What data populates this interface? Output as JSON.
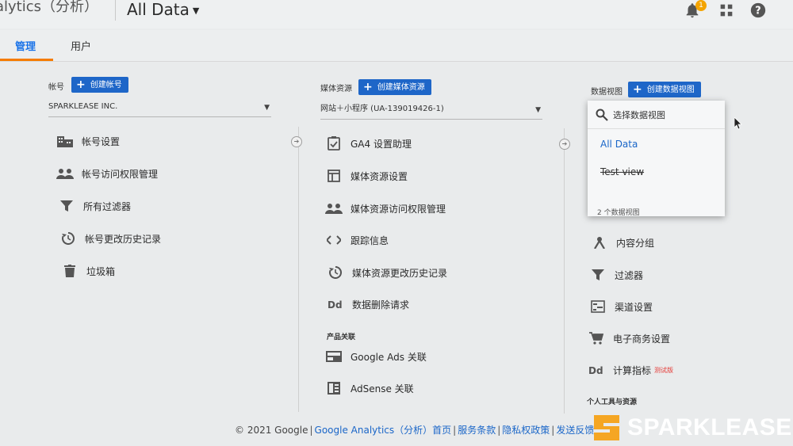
{
  "header": {
    "app_title": "alytics（分析）",
    "data_view": "All Data",
    "notification_count": "1"
  },
  "tabs": [
    {
      "label": "管理"
    },
    {
      "label": "用户"
    }
  ],
  "account_column": {
    "label": "帐号",
    "create_label": "创建帐号",
    "selected": "SPARKLEASE INC.",
    "items": [
      {
        "label": "帐号设置",
        "icon": "building-icon"
      },
      {
        "label": "帐号访问权限管理",
        "icon": "people-icon"
      },
      {
        "label": "所有过滤器",
        "icon": "filter-icon"
      },
      {
        "label": "帐号更改历史记录",
        "icon": "history-icon"
      },
      {
        "label": "垃圾箱",
        "icon": "trash-icon"
      }
    ]
  },
  "property_column": {
    "label": "媒体资源",
    "create_label": "创建媒体资源",
    "selected": "网站＋小程序 (UA-139019426-1)",
    "items": [
      {
        "label": "GA4 设置助理",
        "icon": "checklist-icon"
      },
      {
        "label": "媒体资源设置",
        "icon": "property-settings-icon"
      },
      {
        "label": "媒体资源访问权限管理",
        "icon": "people-icon"
      },
      {
        "label": "跟踪信息",
        "icon": "code-icon"
      },
      {
        "label": "媒体资源更改历史记录",
        "icon": "history-icon"
      },
      {
        "label": "数据删除请求",
        "icon": "dd-icon"
      }
    ],
    "product_links_label": "产品关联",
    "product_links": [
      {
        "label": "Google Ads 关联",
        "icon": "google-ads-icon"
      },
      {
        "label": "AdSense 关联",
        "icon": "adsense-icon"
      }
    ]
  },
  "view_column": {
    "label": "数据视图",
    "create_label": "创建数据视图",
    "dropdown": {
      "search_placeholder": "选择数据视图",
      "options": [
        {
          "label": "All Data",
          "selected": true
        },
        {
          "label": "Test view",
          "strikethrough": true
        }
      ],
      "count_label": "2 个数据视图"
    },
    "items": [
      {
        "label": "内容分组",
        "icon": "content-grouping-icon"
      },
      {
        "label": "过滤器",
        "icon": "filter-icon"
      },
      {
        "label": "渠道设置",
        "icon": "channel-settings-icon"
      },
      {
        "label": "电子商务设置",
        "icon": "cart-icon"
      },
      {
        "label": "计算指标",
        "tag": "测试版",
        "icon": "dd-icon"
      }
    ],
    "personal_tools_label": "个人工具与资源"
  },
  "footer": {
    "copyright": "© 2021 Google",
    "links": [
      "Google Analytics（分析）首页",
      "服务条款",
      "隐私权政策",
      "发送反馈"
    ]
  },
  "brand": {
    "name": "SPARKLEASE",
    "color": "#f5a623"
  },
  "colors": {
    "primary_button": "#1e66c8",
    "active_tab": "#1a73e8",
    "tab_underline": "#f57c00"
  }
}
